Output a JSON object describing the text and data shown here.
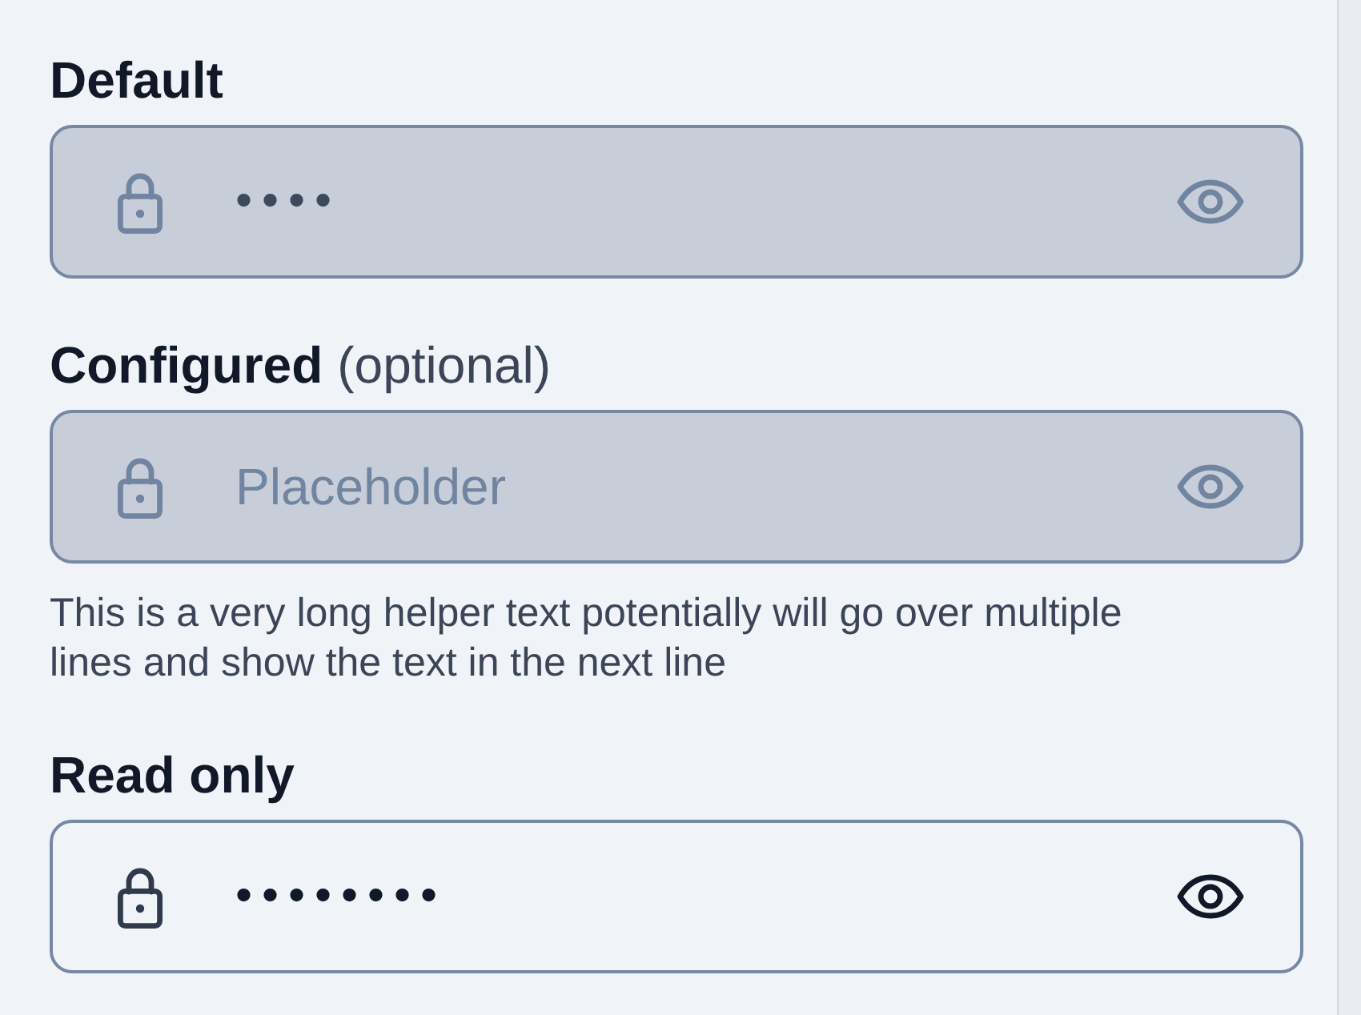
{
  "fields": [
    {
      "label": "Default",
      "value": "••••",
      "read_only": false
    },
    {
      "label": "Configured",
      "optional_text": "(optional)",
      "placeholder": "Placeholder",
      "helper_text": "This is a very long helper text potentially will go over multiple lines and show the text in the next line",
      "read_only": false
    },
    {
      "label": "Read only",
      "value": "••••••••",
      "read_only": true
    }
  ]
}
